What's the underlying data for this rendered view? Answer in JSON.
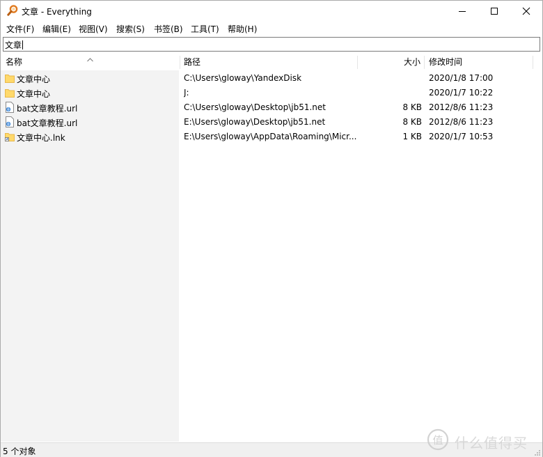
{
  "window": {
    "title": "文章 - Everything",
    "icon": "everything-magnifier-icon"
  },
  "menu": {
    "file": "文件(F)",
    "edit": "编辑(E)",
    "view": "视图(V)",
    "search": "搜索(S)",
    "bookmarks": "书签(B)",
    "tools": "工具(T)",
    "help": "帮助(H)"
  },
  "search": {
    "value": "文章"
  },
  "columns": {
    "name": "名称",
    "path": "路径",
    "size": "大小",
    "modified": "修改时间",
    "sort": "name-ascending"
  },
  "results": [
    {
      "icon": "folder-icon",
      "name": "文章中心",
      "path": "C:\\Users\\gloway\\YandexDisk",
      "size": "",
      "modified": "2020/1/8 17:00"
    },
    {
      "icon": "folder-icon",
      "name": "文章中心",
      "path": "J:",
      "size": "",
      "modified": "2020/1/7 10:22"
    },
    {
      "icon": "url-file-icon",
      "name": "bat文章教程.url",
      "path": "C:\\Users\\gloway\\Desktop\\jb51.net",
      "size": "8 KB",
      "modified": "2012/8/6 11:23"
    },
    {
      "icon": "url-file-icon",
      "name": "bat文章教程.url",
      "path": "E:\\Users\\gloway\\Desktop\\jb51.net",
      "size": "8 KB",
      "modified": "2012/8/6 11:23"
    },
    {
      "icon": "folder-shortcut-icon",
      "name": "文章中心.lnk",
      "path": "E:\\Users\\gloway\\AppData\\Roaming\\Micr...",
      "size": "1 KB",
      "modified": "2020/1/7 10:53"
    }
  ],
  "status": {
    "count": "5 个对象"
  },
  "watermark": {
    "text": "什么值得买",
    "logo": "zhi-logo"
  },
  "colors": {
    "folder": "#ffd96b",
    "folder_dark": "#e8b84a",
    "app_icon": "#e07a1f",
    "name_column_bg": "#f3f3f3"
  }
}
